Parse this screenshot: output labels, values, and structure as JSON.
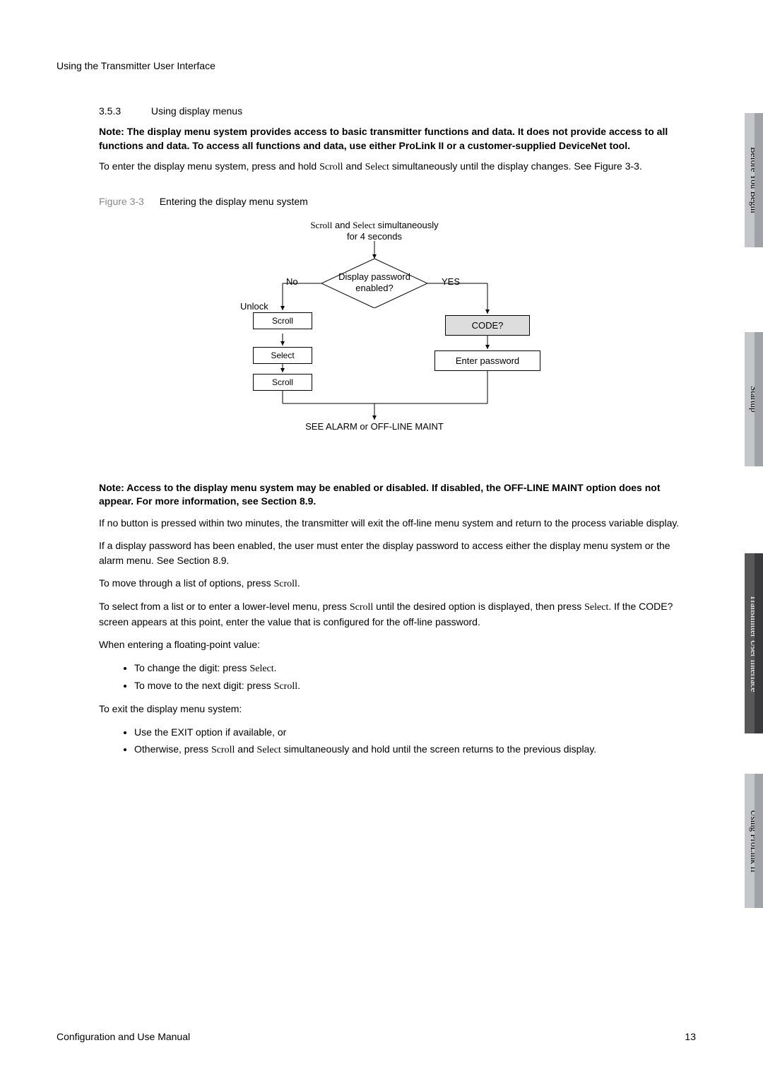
{
  "header": "Using the Transmitter User Interface",
  "section": {
    "num": "3.5.3",
    "title": "Using display menus"
  },
  "note1": "Note: The display menu system provides access to basic transmitter functions and data. It does not provide access to all functions and data. To access all functions and data, use either ProLink II or a customer-supplied DeviceNet tool.",
  "para1_a": "To enter the display menu system, press and hold ",
  "para1_b": " and ",
  "para1_c": " simultaneously until the display changes. See Figure 3-3.",
  "figure": {
    "label": "Figure 3-3",
    "title": "Entering the display menu system"
  },
  "flow": {
    "start_a": "Scroll",
    "start_b": " and ",
    "start_c": "Select",
    "start_d": " simultaneously",
    "start_e": "for 4 seconds",
    "diamond_a": "Display password",
    "diamond_b": "enabled?",
    "no": "No",
    "yes": "YES",
    "unlock": "Unlock",
    "btn_scroll": "Scroll",
    "btn_select": "Select",
    "code": "CODE?",
    "enter_pw": "Enter password",
    "end": "SEE ALARM or OFF-LINE MAINT"
  },
  "note2": "Note: Access to the display menu system may be enabled or disabled. If disabled, the OFF-LINE MAINT option does not appear. For more information, see Section 8.9.",
  "p2": "If no button is pressed within two minutes, the transmitter will exit the off-line menu system and return to the process variable display.",
  "p3": "If a display password has been enabled, the user must enter the display password to access either the display menu system or the alarm menu. See Section 8.9.",
  "p4": {
    "a": "To move through a list of options, press ",
    "b": "."
  },
  "p5": {
    "a": "To select from a list or to enter a lower-level menu, press ",
    "b": " until the desired option is displayed, then press ",
    "c": ". If the CODE? screen appears at this point, enter the value that is configured for the off-line password."
  },
  "p6": "When entering a floating-point value:",
  "b1": {
    "a": "To change the digit: press ",
    "s": "Select",
    "b": "."
  },
  "b2": {
    "a": "To move to the next digit: press ",
    "s": "Scroll",
    "b": "."
  },
  "p7": "To exit the display menu system:",
  "b3": {
    "a": "Use the ",
    "s": "EXIT",
    "b": " option if available, or"
  },
  "b4": {
    "a": "Otherwise, press ",
    "s": "Scroll",
    "b": " and ",
    "s2": "Select",
    "c": " simultaneously and hold until the screen returns to the previous display."
  },
  "scroll": "Scroll",
  "select": "Select",
  "tabs": {
    "t1": "Before You Begin",
    "t2": "Startup",
    "t3": "Transmitter User Interface",
    "t4": "Using ProLink II"
  },
  "footer": {
    "left": "Configuration and Use Manual",
    "right": "13"
  }
}
